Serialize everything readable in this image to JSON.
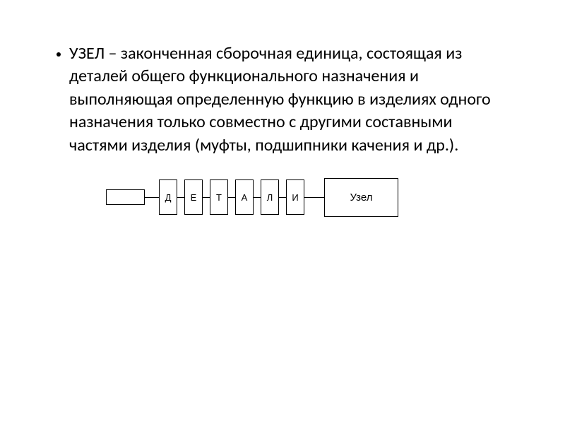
{
  "bullet_text": "УЗЕЛ – законченная сборочная единица, состоящая из деталей общего функционального назначения и выполняющая определенную функцию в изделиях одного назначения только совместно с другими составными частями изделия (муфты, подшипники качения и др.).",
  "diagram": {
    "details": [
      "Д",
      "Е",
      "Т",
      "А",
      "Л",
      "И"
    ],
    "node_label": "Узел"
  }
}
